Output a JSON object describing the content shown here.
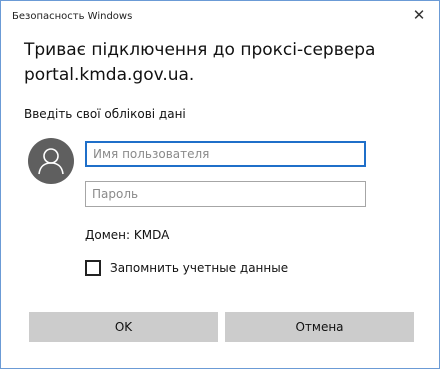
{
  "window": {
    "title": "Безопасность Windows",
    "close_label": "✕"
  },
  "dialog": {
    "heading": "Триває підключення до проксі-сервера portal.kmda.gov.ua.",
    "subheading": "Введіть свої облікові дані",
    "username": {
      "value": "",
      "placeholder": "Имя пользователя"
    },
    "password": {
      "value": "",
      "placeholder": "Пароль"
    },
    "domain_text": "Домен: KMDA",
    "remember_label": "Запомнить учетные данные",
    "remember_checked": false,
    "ok_label": "OK",
    "cancel_label": "Отмена"
  },
  "colors": {
    "accent": "#1f6fc9",
    "button_bg": "#cccccc",
    "avatar_bg": "#5f5f5f",
    "window_border": "#6b9bd6"
  },
  "icons": {
    "avatar": "user-silhouette-icon",
    "close": "close-icon"
  }
}
